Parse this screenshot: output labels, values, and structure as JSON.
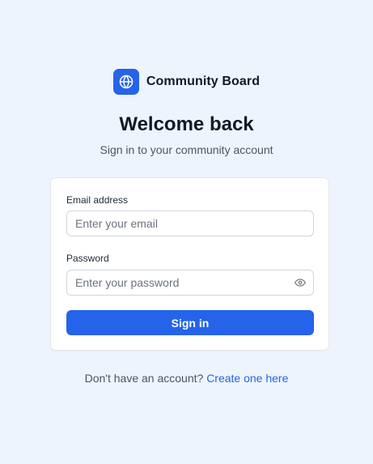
{
  "brand": {
    "name": "Community Board",
    "icon": "globe-icon",
    "color": "#2563eb"
  },
  "header": {
    "title": "Welcome back",
    "subtitle": "Sign in to your community account"
  },
  "form": {
    "email": {
      "label": "Email address",
      "placeholder": "Enter your email",
      "value": ""
    },
    "password": {
      "label": "Password",
      "placeholder": "Enter your password",
      "value": "",
      "toggle_icon": "eye-icon"
    },
    "submit_label": "Sign in"
  },
  "footer": {
    "prompt": "Don't have an account?",
    "link_label": "Create one here"
  }
}
